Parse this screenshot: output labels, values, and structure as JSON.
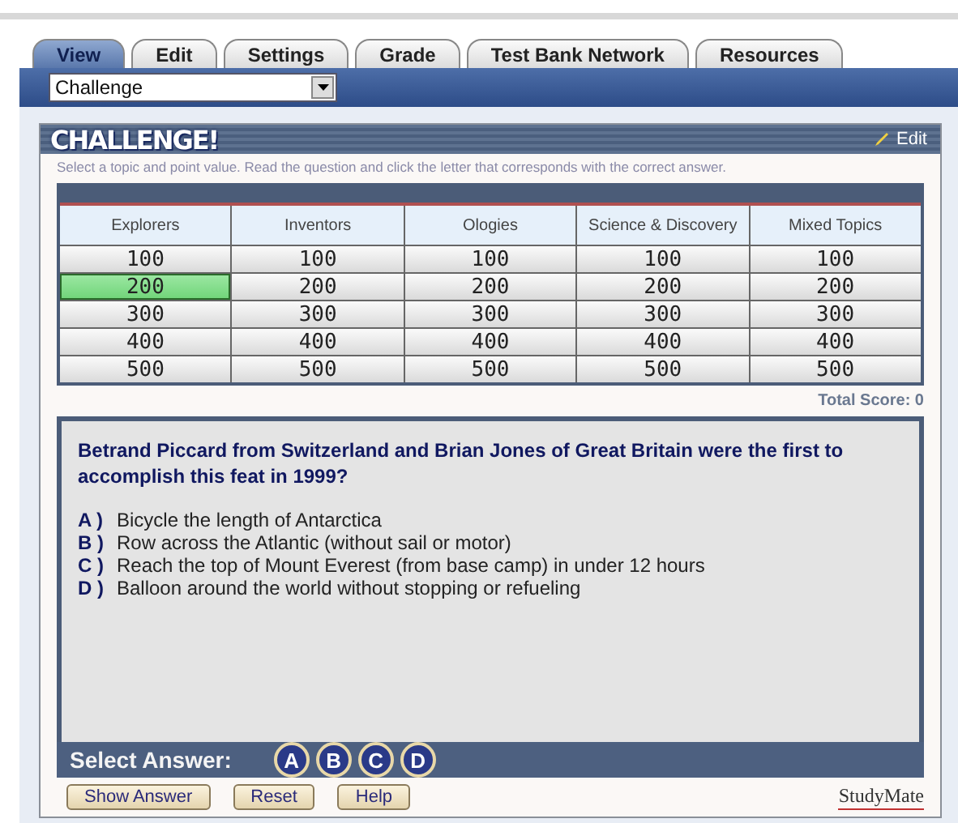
{
  "tabs": [
    {
      "label": "View",
      "selected": true
    },
    {
      "label": "Edit",
      "selected": false
    },
    {
      "label": "Settings",
      "selected": false
    },
    {
      "label": "Grade",
      "selected": false
    },
    {
      "label": "Test Bank Network",
      "selected": false
    },
    {
      "label": "Resources",
      "selected": false
    }
  ],
  "mode_select": {
    "value": "Challenge"
  },
  "panel": {
    "logo": "CHALLENGE!",
    "edit_link": "Edit",
    "instructions": "Select a topic and point value. Read the question and click the letter that corresponds with the correct answer."
  },
  "board": {
    "columns": [
      "Explorers",
      "Inventors",
      "Ologies",
      "Science & Discovery",
      "Mixed Topics"
    ],
    "rows": [
      [
        {
          "value": "100",
          "selected": false
        },
        {
          "value": "100",
          "selected": false
        },
        {
          "value": "100",
          "selected": false
        },
        {
          "value": "100",
          "selected": false
        },
        {
          "value": "100",
          "selected": false
        }
      ],
      [
        {
          "value": "200",
          "selected": true
        },
        {
          "value": "200",
          "selected": false
        },
        {
          "value": "200",
          "selected": false
        },
        {
          "value": "200",
          "selected": false
        },
        {
          "value": "200",
          "selected": false
        }
      ],
      [
        {
          "value": "300",
          "selected": false
        },
        {
          "value": "300",
          "selected": false
        },
        {
          "value": "300",
          "selected": false
        },
        {
          "value": "300",
          "selected": false
        },
        {
          "value": "300",
          "selected": false
        }
      ],
      [
        {
          "value": "400",
          "selected": false
        },
        {
          "value": "400",
          "selected": false
        },
        {
          "value": "400",
          "selected": false
        },
        {
          "value": "400",
          "selected": false
        },
        {
          "value": "400",
          "selected": false
        }
      ],
      [
        {
          "value": "500",
          "selected": false
        },
        {
          "value": "500",
          "selected": false
        },
        {
          "value": "500",
          "selected": false
        },
        {
          "value": "500",
          "selected": false
        },
        {
          "value": "500",
          "selected": false
        }
      ]
    ],
    "total_score": "Total Score: 0"
  },
  "question": {
    "text": "Betrand Piccard from Switzerland and Brian Jones of Great Britain were the first to accomplish this feat in 1999?",
    "answers": [
      {
        "letter": "A )",
        "text": "Bicycle the length of Antarctica"
      },
      {
        "letter": "B )",
        "text": "Row across the Atlantic (without sail or motor)"
      },
      {
        "letter": "C )",
        "text": "Reach the top of Mount Everest (from base camp) in under 12 hours"
      },
      {
        "letter": "D )",
        "text": "Balloon around the world without stopping or refueling"
      }
    ]
  },
  "answer_bar": {
    "label": "Select Answer:",
    "choices": [
      "A",
      "B",
      "C",
      "D"
    ]
  },
  "buttons": [
    "Show Answer",
    "Reset",
    "Help"
  ],
  "brand": "StudyMate"
}
